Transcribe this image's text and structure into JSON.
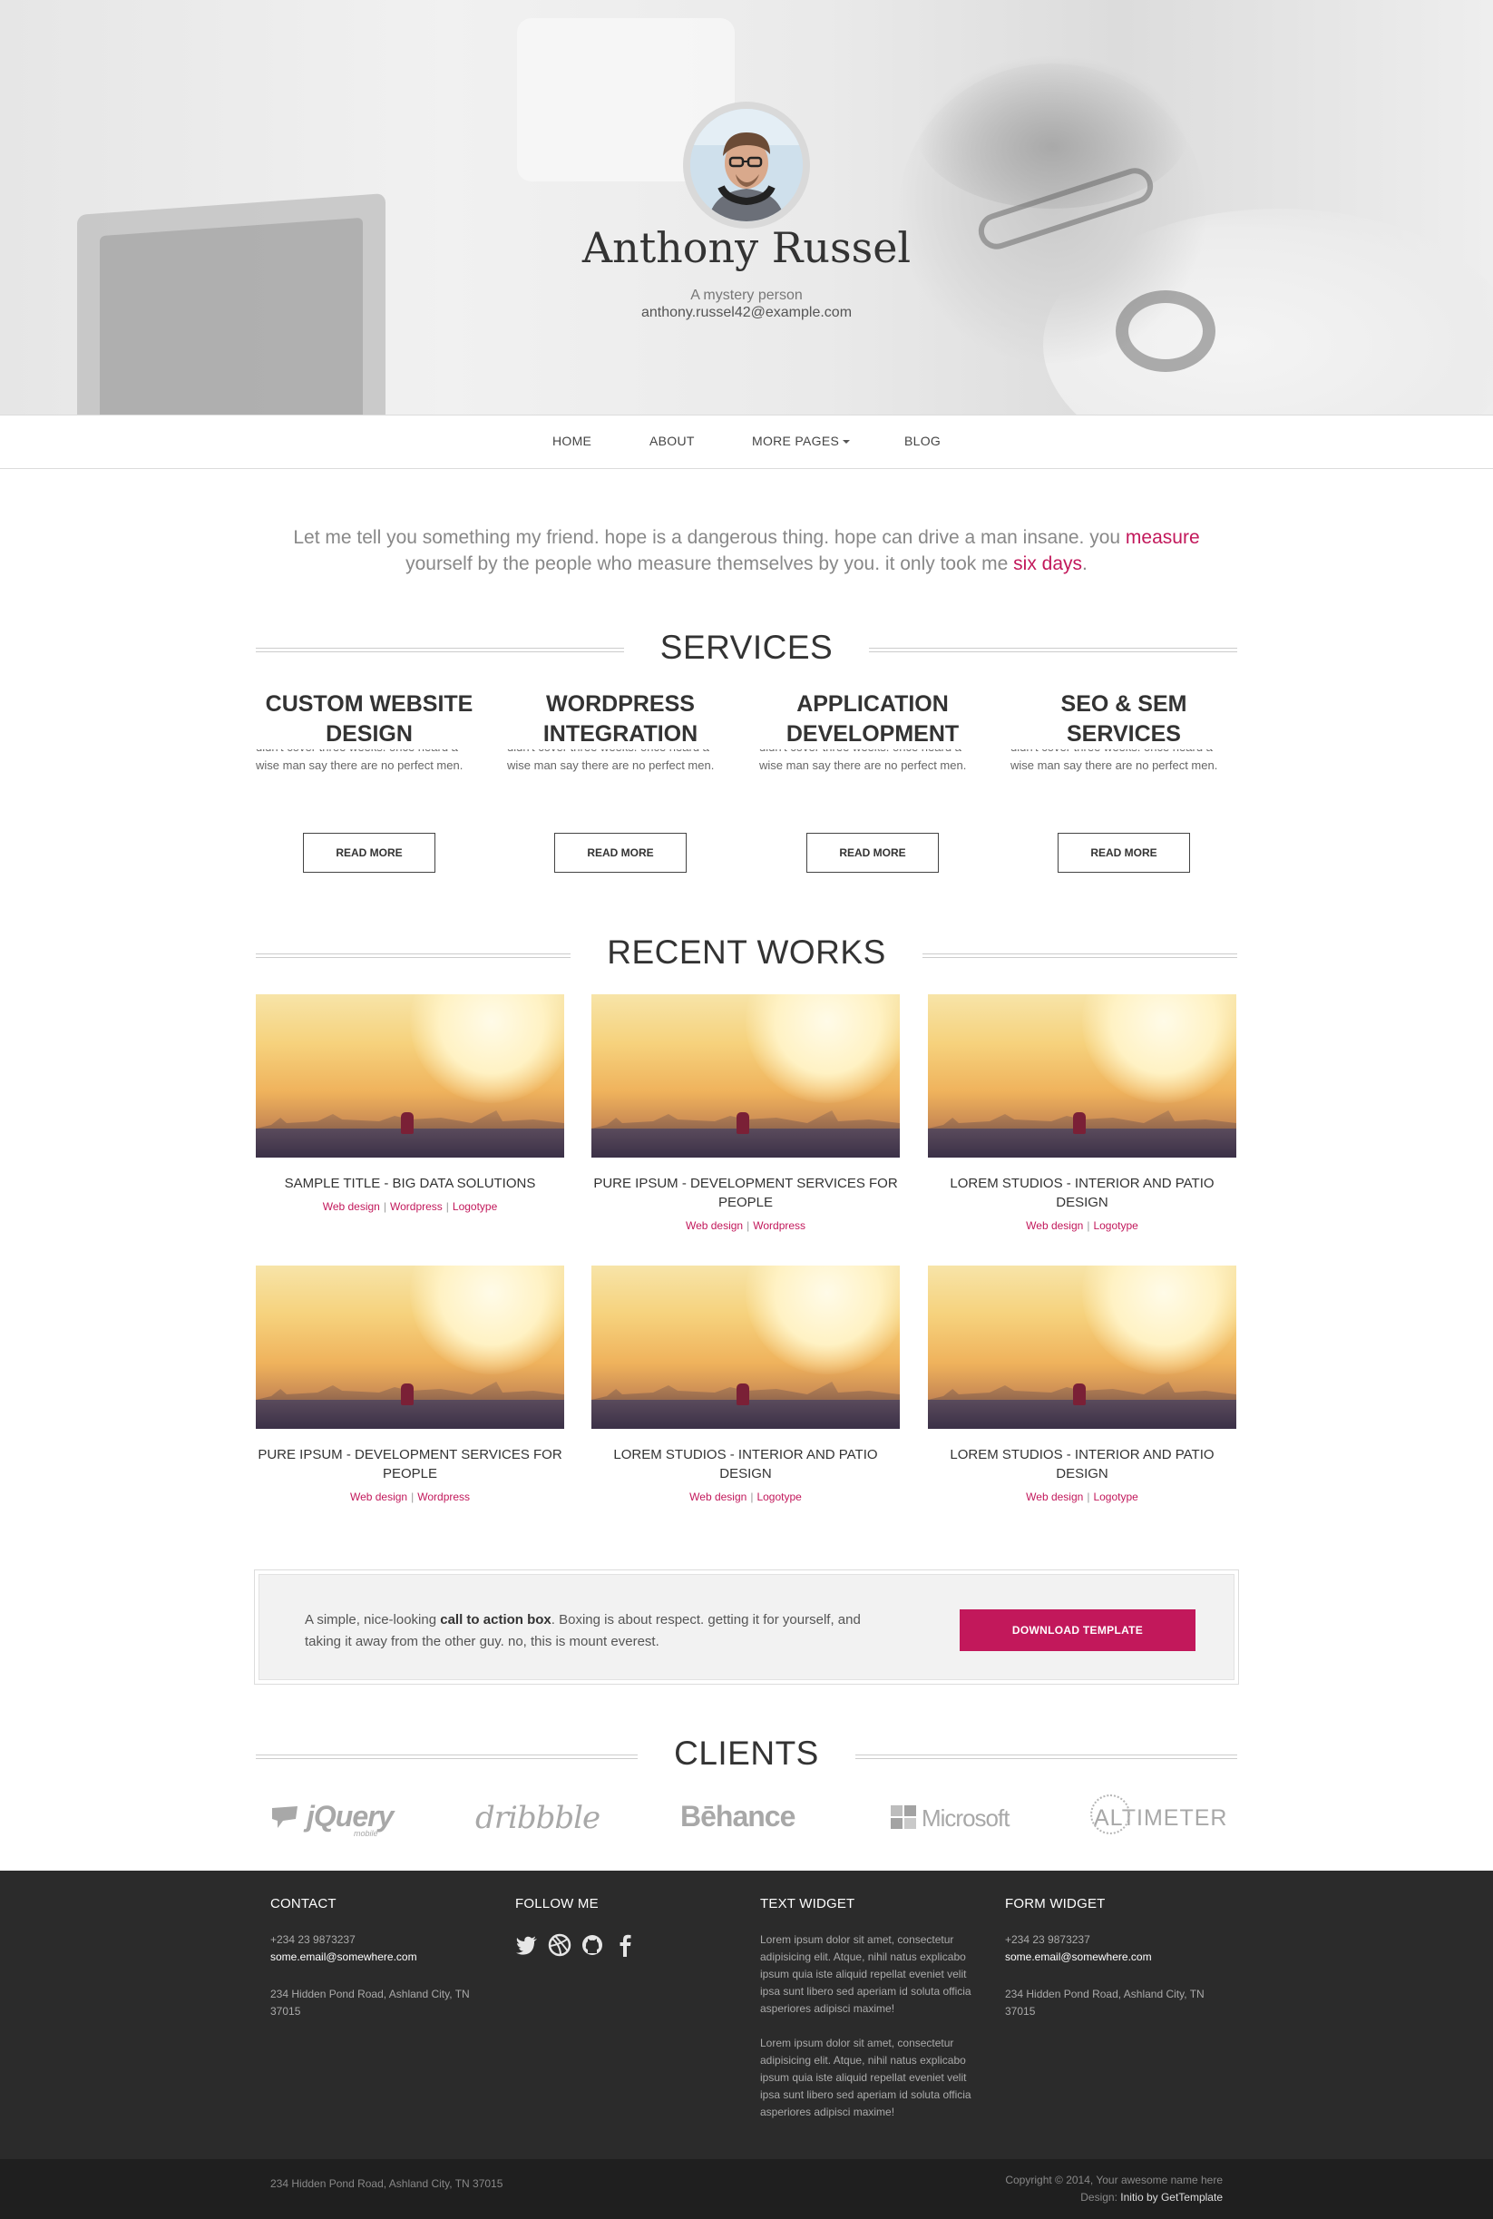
{
  "profile": {
    "name": "Anthony Russel",
    "tagline": "A mystery person",
    "email": "anthony.russel42@example.com"
  },
  "nav": {
    "items": [
      {
        "label": "HOME"
      },
      {
        "label": "ABOUT"
      },
      {
        "label": "MORE PAGES"
      },
      {
        "label": "BLOG"
      }
    ]
  },
  "intro": {
    "text_before": "Let me tell you something my friend. hope is a dangerous thing. hope can drive a man insane. you",
    "highlight1": "measure",
    "text_middle": "yourself by the people who measure themselves by you. it only took me",
    "highlight2": "six days",
    "text_end": "."
  },
  "services": {
    "title": "SERVICES",
    "items": [
      {
        "title": "CUSTOM WEBSITE DESIGN",
        "text": "didn't cover three weeks. once heard a wise man say there are no perfect men.",
        "button": "READ MORE"
      },
      {
        "title": "WORDPRESS INTEGRATION",
        "text": "didn't cover three weeks. once heard a wise man say there are no perfect men.",
        "button": "READ MORE"
      },
      {
        "title": "APPLICATION DEVELOPMENT",
        "text": "didn't cover three weeks. once heard a wise man say there are no perfect men.",
        "button": "READ MORE"
      },
      {
        "title": "SEO & SEM SERVICES",
        "text": "didn't cover three weeks. once heard a wise man say there are no perfect men.",
        "button": "READ MORE"
      }
    ]
  },
  "works": {
    "title": "RECENT WORKS",
    "items": [
      {
        "title": "SAMPLE TITLE - BIG DATA SOLUTIONS",
        "tags": [
          "Web design",
          "Wordpress",
          "Logotype"
        ]
      },
      {
        "title": "PURE IPSUM - DEVELOPMENT SERVICES FOR PEOPLE",
        "tags": [
          "Web design",
          "Wordpress"
        ]
      },
      {
        "title": "LOREM STUDIOS - INTERIOR AND PATIO DESIGN",
        "tags": [
          "Web design",
          "Logotype"
        ]
      },
      {
        "title": "PURE IPSUM - DEVELOPMENT SERVICES FOR PEOPLE",
        "tags": [
          "Web design",
          "Wordpress"
        ]
      },
      {
        "title": "LOREM STUDIOS - INTERIOR AND PATIO DESIGN",
        "tags": [
          "Web design",
          "Logotype"
        ]
      },
      {
        "title": "LOREM STUDIOS - INTERIOR AND PATIO DESIGN",
        "tags": [
          "Web design",
          "Logotype"
        ]
      }
    ]
  },
  "cta": {
    "text_before": "A simple, nice-looking",
    "bold": "call to action box",
    "text_after": ". Boxing is about respect. getting it for yourself, and taking it away from the other guy. no, this is mount everest.",
    "button": "DOWNLOAD TEMPLATE"
  },
  "clients": {
    "title": "CLIENTS",
    "logos": [
      "jQuery",
      "dribbble",
      "Bēhance",
      "Microsoft",
      "ALTIMETER"
    ],
    "jquery_sub": "mobile"
  },
  "footer": {
    "contact": {
      "title": "CONTACT",
      "phone": "+234 23 9873237",
      "email": "some.email@somewhere.com",
      "address": "234 Hidden Pond Road, Ashland City, TN 37015"
    },
    "follow": {
      "title": "FOLLOW ME",
      "icons": [
        "twitter-icon",
        "dribbble-icon",
        "github-icon",
        "facebook-icon"
      ]
    },
    "text_widget": {
      "title": "TEXT WIDGET",
      "para1": "Lorem ipsum dolor sit amet, consectetur adipisicing elit. Atque, nihil natus explicabo ipsum quia iste aliquid repellat eveniet velit ipsa sunt libero sed aperiam id soluta officia asperiores adipisci maxime!",
      "para2": "Lorem ipsum dolor sit amet, consectetur adipisicing elit. Atque, nihil natus explicabo ipsum quia iste aliquid repellat eveniet velit ipsa sunt libero sed aperiam id soluta officia asperiores adipisci maxime!"
    },
    "form_widget": {
      "title": "FORM WIDGET",
      "phone": "+234 23 9873237",
      "email": "some.email@somewhere.com",
      "address": "234 Hidden Pond Road, Ashland City, TN 37015"
    }
  },
  "subfooter": {
    "address": "234 Hidden Pond Road, Ashland City, TN 37015",
    "copyright": "Copyright © 2014, Your awesome name here",
    "design_label": "Design:",
    "design_credit": "Initio by GetTemplate"
  },
  "colors": {
    "accent": "#c2185b",
    "footer_bg": "#2b2b2b",
    "subfooter_bg": "#1f1f1f"
  }
}
